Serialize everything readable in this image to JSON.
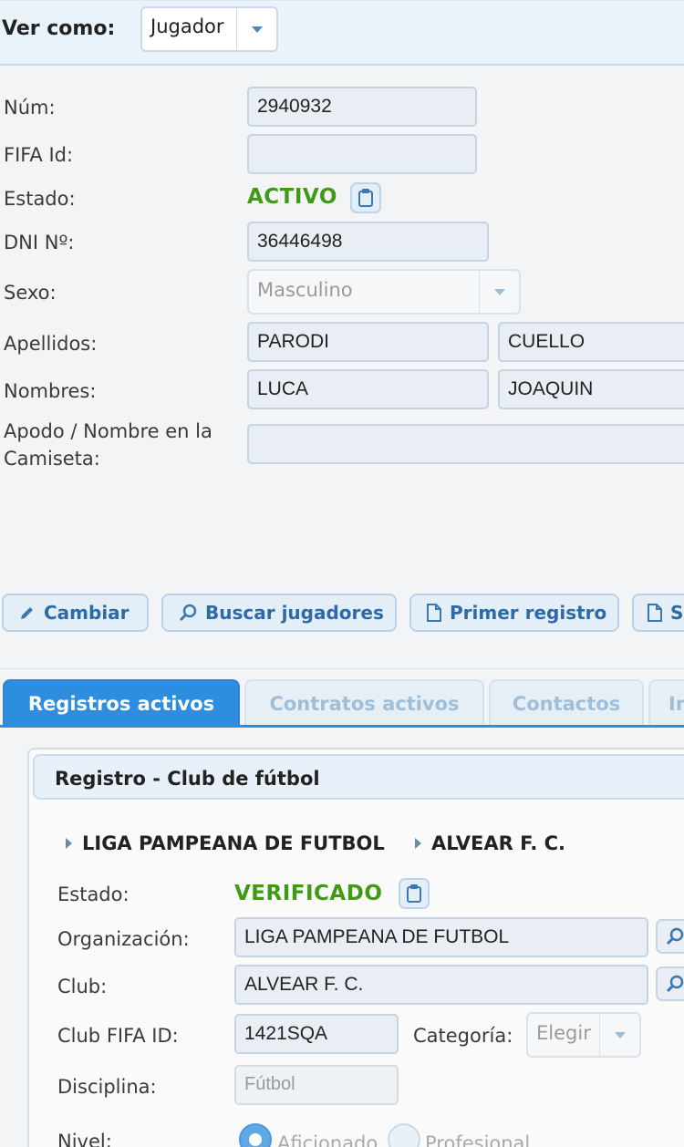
{
  "header": {
    "ver_como_label": "Ver como:",
    "view_as_value": "Jugador"
  },
  "form": {
    "num_label": "Núm:",
    "num_value": "2940932",
    "fifa_label": "FIFA Id:",
    "fifa_value": "",
    "estado_label": "Estado:",
    "estado_value": "ACTIVO",
    "dni_label": "DNI Nº:",
    "dni_value": "36446498",
    "sexo_label": "Sexo:",
    "sexo_value": "Masculino",
    "apellidos_label": "Apellidos:",
    "apellido1": "PARODI",
    "apellido2": "CUELLO",
    "nombres_label": "Nombres:",
    "nombre1": "LUCA",
    "nombre2": "JOAQUIN",
    "apodo_label_line1": "Apodo / Nombre en la",
    "apodo_label_line2": "Camiseta:",
    "apodo_value": ""
  },
  "actions": {
    "cambiar": "Cambiar",
    "buscar": "Buscar jugadores",
    "primer": "Primer registro",
    "next_partial": "S"
  },
  "tabs": {
    "registros": "Registros activos",
    "contratos": "Contratos activos",
    "contactos": "Contactos",
    "partial": "In"
  },
  "registro": {
    "title": "Registro - Club de fútbol",
    "breadcrumb": [
      "LIGA PAMPEANA DE FUTBOL",
      "ALVEAR F. C."
    ],
    "estado_label": "Estado:",
    "estado_value": "VERIFICADO",
    "org_label": "Organización:",
    "org_value": "LIGA PAMPEANA DE FUTBOL",
    "club_label": "Club:",
    "club_value": "ALVEAR F. C.",
    "club_fifa_label": "Club FIFA ID:",
    "club_fifa_value": "1421SQA",
    "categoria_label": "Categoría:",
    "categoria_value": "Elegir",
    "disciplina_label": "Disciplina:",
    "disciplina_value": "Fútbol",
    "nivel_label": "Nivel:",
    "nivel_opt1": "Aficionado",
    "nivel_opt2": "Profesional"
  },
  "colors": {
    "accent": "#2d8ee0",
    "status_green": "#3f9a14",
    "link_blue": "#2e6aa6"
  }
}
